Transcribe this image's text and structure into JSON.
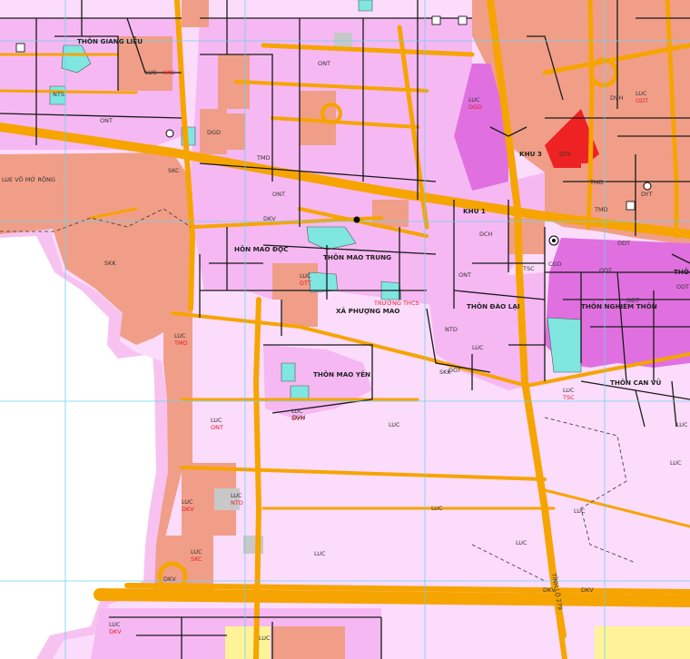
{
  "map": {
    "colors": {
      "background": "#ffffff",
      "residential": "#f6b8f2",
      "agricultural": "#fcdcfb",
      "industrial": "#f19e88",
      "urban": "#e070e0",
      "road": "#f6a400",
      "water": "#7fe6e0",
      "boundary": "#1a1a1a",
      "grid": "#6ad2ee",
      "outer_buffer": "#f7c2f0",
      "red_zone": "#ee2222",
      "yellow_zone": "#fff39a",
      "gray": "#c8c8c8"
    },
    "place_names": {
      "giang_lieu": "THÔN GIANG LIỄU",
      "mao_doc": "HÔN MAO ĐỘC",
      "mao_trung": "THÔN MAO TRUNG",
      "phuong_mao": "XÃ PHƯỢNG MAO",
      "mao_yen": "THÔN MAO YÊN",
      "dao_lai": "THÔN ĐÀO LẠI",
      "nghiem_xa": "THÔN NGHIÊM THÔN",
      "can_vu": "THÔN CAN VŨ",
      "khu3": "KHU 3",
      "khu1": "KHU 1",
      "khu_vo_mo_rong": "LUE VÕ MỞ RỘNG",
      "truong": "TRƯỜNG THCS",
      "road": "TỈNH LỘ 279",
      "edge_left": "THÔ"
    },
    "zone_labels": [
      {
        "code": "LUC",
        "sub": "SKC"
      },
      {
        "code": "LUC",
        "sub": "ONT"
      },
      {
        "code": "LUC",
        "sub": "TMD"
      },
      {
        "code": "LUC",
        "sub": "DGD"
      },
      {
        "code": "LUC",
        "sub": "DVH"
      },
      {
        "code": "LUC",
        "sub": "DKV"
      },
      {
        "code": "LUC",
        "sub": "NTD"
      },
      {
        "code": "LUC",
        "sub": "DTT"
      },
      {
        "code": "LUC",
        "sub": "TSC"
      },
      {
        "code": "LUC",
        "sub": "ODT"
      },
      {
        "code": "LUC",
        "sub": "SKC"
      },
      {
        "code": "LUC",
        "sub": "DKV"
      }
    ],
    "codes": [
      "ONT",
      "ONT",
      "ONT",
      "ONT",
      "SKK",
      "SKC",
      "DGD",
      "DVH",
      "DKV",
      "TMD",
      "NTS",
      "ODT",
      "DCH",
      "DYT",
      "DTS",
      "TSC",
      "NTD",
      "CGD",
      "DGT",
      "DKV",
      "DKV",
      "DKV",
      "LUC",
      "LUC",
      "LUC",
      "LUC",
      "LUC",
      "LUC",
      "LUC",
      "LUC",
      "LUC",
      "ODT",
      "ODT",
      "ODT",
      "TMD",
      "TMD",
      "DVH",
      "SKK"
    ]
  }
}
